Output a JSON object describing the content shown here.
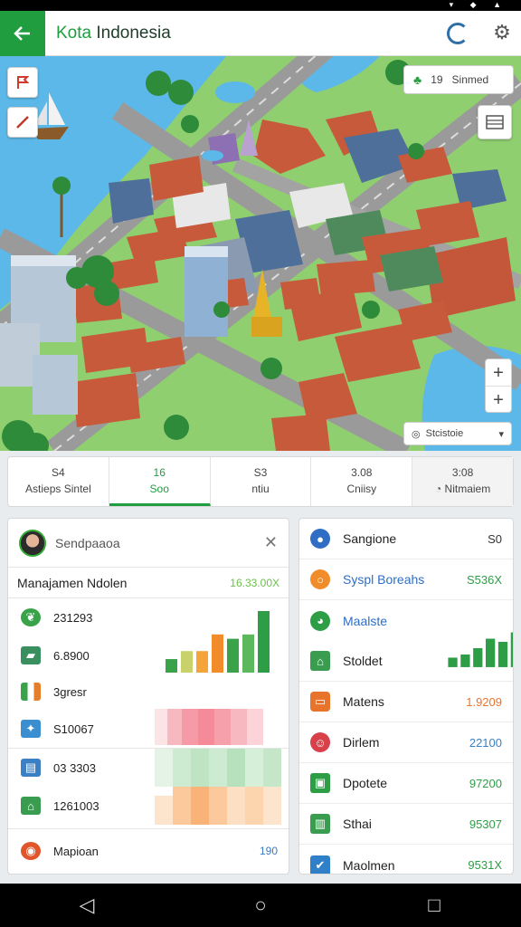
{
  "header": {
    "title_green": "Kota",
    "title_rest": " Indonesia"
  },
  "map": {
    "legend_value": "19",
    "legend_label": "Sinmed",
    "layer_label": "Stcistoie",
    "layer_caret": "▾",
    "zoom_in": "+",
    "zoom_out": "+"
  },
  "tabs": [
    {
      "value": "S4",
      "label": "Astieps Sintel"
    },
    {
      "value": "16",
      "label": "Soo"
    },
    {
      "value": "S3",
      "label": "ntiu"
    },
    {
      "value": "3.08",
      "label": "Cniisy"
    },
    {
      "value": "3:08",
      "label": "Nitmaiem"
    }
  ],
  "left_panel": {
    "header_name": "Sendpaaoa",
    "close": "✕",
    "subheader_label": "Manajamen Ndolen",
    "subheader_value": "16.33.00X",
    "rows": [
      {
        "label": "231293",
        "icon_color": "#3aa34a"
      },
      {
        "label": "6.8900",
        "icon_color": "#3a8f5e"
      },
      {
        "label": "3gresr",
        "icon_color": "#e67d2a"
      },
      {
        "label": "S10067",
        "icon_color": "#3b8fd1"
      },
      {
        "label": "03 3303",
        "icon_color": "#3b7fc4"
      },
      {
        "label": "1261003",
        "icon_color": "#3a9c4e"
      },
      {
        "label": "Mapioan",
        "icon_color": "#e0552b",
        "value": "190"
      }
    ]
  },
  "right_panel": {
    "rows": [
      {
        "label": "Sangione",
        "value": "S0",
        "icon_color": "#2f6ec4",
        "value_color": "#333"
      },
      {
        "label": "Syspl Boreahs",
        "value": "S536X",
        "icon_color": "#f08c2a",
        "value_color": "#2e9e46",
        "label_color": "#2f6ec4"
      },
      {
        "label": "Maalste",
        "value": "",
        "icon_color": "#2e9e46",
        "value_color": "#333",
        "label_color": "#2f6ec4"
      },
      {
        "label": "Stoldet",
        "value": "",
        "icon_color": "#3a9c4e",
        "value_color": "#333"
      },
      {
        "label": "Matens",
        "value": "1.9209",
        "icon_color": "#e8742c",
        "value_color": "#e8742c"
      },
      {
        "label": "Dirlem",
        "value": "22100",
        "icon_color": "#d8404a",
        "value_color": "#3b7fc4"
      },
      {
        "label": "Dpotete",
        "value": "97200",
        "icon_color": "#2e9e46",
        "value_color": "#2e9e46"
      },
      {
        "label": "Sthai",
        "value": "95307",
        "icon_color": "#3a9c4e",
        "value_color": "#2e9e46"
      },
      {
        "label": "Maolmen",
        "value": "9531X",
        "icon_color": "#2f80c8",
        "value_color": "#2e9e46"
      }
    ]
  },
  "left_bar_chart": {
    "colors": [
      "#3aa34a",
      "#c9d16a",
      "#f5a33b",
      "#f28c2a",
      "#3aa34a",
      "#5cb85c",
      "#2e9e46"
    ],
    "values": [
      0.22,
      0.35,
      0.35,
      0.62,
      0.55,
      0.62,
      1.0
    ]
  },
  "right_bar_chart": {
    "values": [
      0.15,
      0.2,
      0.3,
      0.45,
      0.4,
      0.55,
      0.7,
      0.85,
      1.0
    ]
  },
  "nav": {
    "back": "◁",
    "home": "○",
    "recent": "□"
  }
}
